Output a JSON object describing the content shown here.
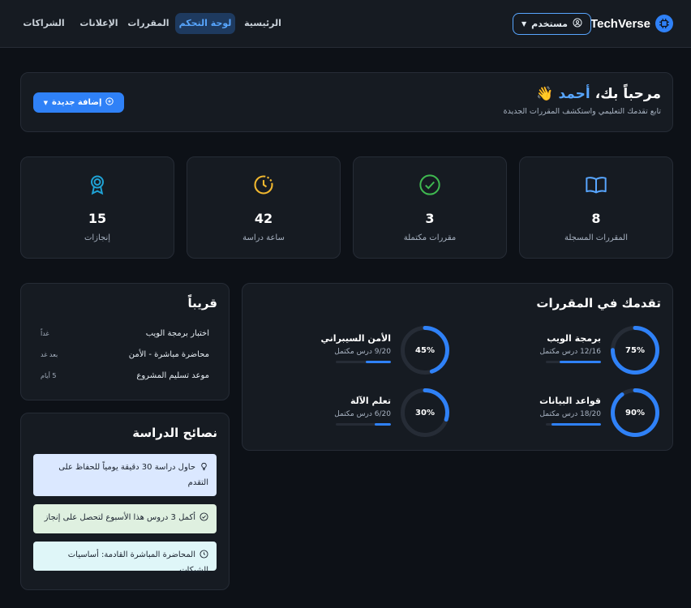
{
  "brand": {
    "name": "TechVerse"
  },
  "nav": {
    "user_label": "مستخدم",
    "items": [
      {
        "label": "الرئيسية"
      },
      {
        "label": "لوحة التحكم"
      },
      {
        "label": "المقررات"
      },
      {
        "label": "الإعلانات"
      },
      {
        "label": "الشراكات"
      }
    ]
  },
  "welcome": {
    "greeting": "مرحباً بك،",
    "name": "أحمد",
    "emoji": "👋",
    "subtitle": "تابع تقدمك التعليمي واستكشف المقررات الجديدة",
    "add_label": "إضافة جديدة"
  },
  "stats": [
    {
      "value": "8",
      "label": "المقررات المسجلة",
      "icon": "book-icon",
      "color": "#58a6ff"
    },
    {
      "value": "3",
      "label": "مقررات مكتملة",
      "icon": "check-circle-icon",
      "color": "#3fb950"
    },
    {
      "value": "42",
      "label": "ساعة دراسة",
      "icon": "clock-icon",
      "color": "#f0b72f"
    },
    {
      "value": "15",
      "label": "إنجازات",
      "icon": "award-icon",
      "color": "#1fa3d6"
    }
  ],
  "progress": {
    "title": "تقدمك في المقررات",
    "items": [
      {
        "name": "برمجة الويب",
        "count": "12/16 درس مكتمل",
        "percent_label": "75%",
        "percent": 75
      },
      {
        "name": "الأمن السيبراني",
        "count": "9/20 درس مكتمل",
        "percent_label": "45%",
        "percent": 45
      },
      {
        "name": "قواعد البيانات",
        "count": "18/20 درس مكتمل",
        "percent_label": "90%",
        "percent": 90
      },
      {
        "name": "تعلم الآلة",
        "count": "6/20 درس مكتمل",
        "percent_label": "30%",
        "percent": 30
      }
    ]
  },
  "upcoming": {
    "title": "قريباً",
    "items": [
      {
        "title": "اختبار برمجة الويب",
        "when": "غداً"
      },
      {
        "title": "محاضرة مباشرة - الأمن",
        "when": "بعد غد"
      },
      {
        "title": "موعد تسليم المشروع",
        "when": "5 أيام"
      }
    ]
  },
  "tips": {
    "title": "نصائح الدراسة",
    "items": [
      {
        "text": "حاول دراسة 30 دقيقة يومياً للحفاظ على التقدم",
        "icon": "lightbulb-icon",
        "bg": "#dbe8ff"
      },
      {
        "text": "أكمل 3 دروس هذا الأسبوع لتحصل على إنجاز",
        "icon": "check-circle-icon",
        "bg": "#dff0e0"
      },
      {
        "text": "المحاضرة المباشرة القادمة: أساسيات الشبكات",
        "icon": "clock-icon",
        "bg": "#dff6f8"
      }
    ]
  }
}
